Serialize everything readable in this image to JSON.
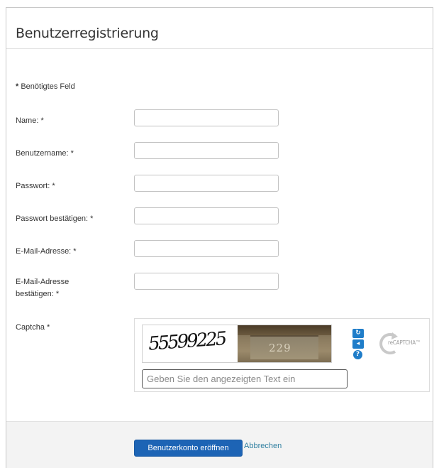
{
  "page_title": "Benutzerregistrierung",
  "required_note": {
    "marker": "*",
    "text": "Benötigtes Feld"
  },
  "fields": [
    {
      "label": "Name: *",
      "value": ""
    },
    {
      "label": "Benutzername: *",
      "value": ""
    },
    {
      "label": "Passwort: *",
      "value": ""
    },
    {
      "label": "Passwort bestätigen: *",
      "value": ""
    },
    {
      "label": "E-Mail-Adresse: *",
      "value": ""
    },
    {
      "label_line1": "E-Mail-Adresse",
      "label_line2": "bestätigen: *",
      "value": ""
    }
  ],
  "captcha": {
    "label": "Captcha *",
    "word_text": "55599225",
    "photo_text": "229",
    "input_placeholder": "Geben Sie den angezeigten Text ein",
    "buttons": [
      {
        "icon": "refresh-icon",
        "glyph": "↻"
      },
      {
        "icon": "audio-icon",
        "glyph": "◂"
      },
      {
        "icon": "help-icon",
        "glyph": "?"
      }
    ],
    "logo_text": "reCAPTCHA™"
  },
  "footer": {
    "submit_label": "Benutzerkonto eröffnen",
    "cancel_label": "Abbrechen"
  },
  "colors": {
    "primary_button": "#1d64b5",
    "link": "#2f7fa0",
    "captcha_button": "#1f7dc9"
  }
}
